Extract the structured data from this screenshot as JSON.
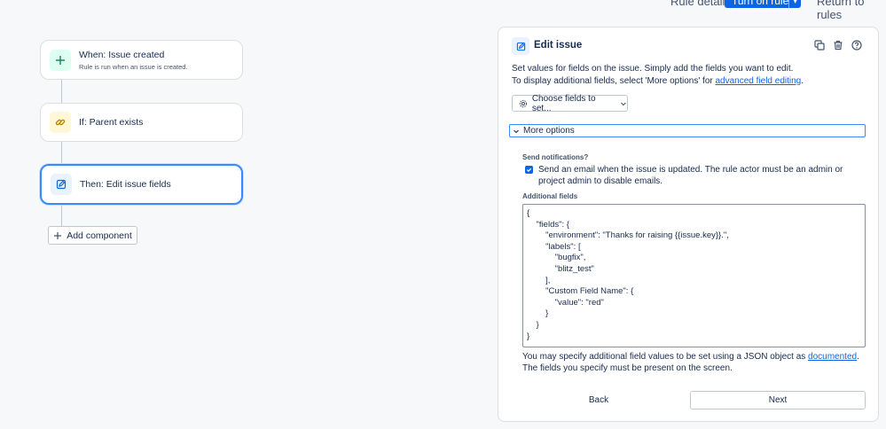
{
  "topbar": {
    "rule_details": "Rule details",
    "turn_on_rule": "Turn on rule",
    "return_to_rules": "Return to rules"
  },
  "flow": {
    "trigger": {
      "title": "When: Issue created",
      "subtitle": "Rule is run when an issue is created.",
      "icon": "plus-icon",
      "color": "#dcfff1"
    },
    "condition": {
      "title": "If: Parent exists",
      "icon": "link-icon",
      "color": "#fff7d6"
    },
    "action": {
      "title": "Then: Edit issue fields",
      "icon": "edit-icon",
      "color": "#e9f2ff"
    },
    "add_component": "Add component"
  },
  "panel": {
    "title": "Edit issue",
    "desc_line1": "Set values for fields on the issue. Simply add the fields you want to edit.",
    "desc_line2_prefix": "To display additional fields, select 'More options' for ",
    "desc_link": "advanced field editing",
    "desc_line2_suffix": ".",
    "choose_fields": "Choose fields to set...",
    "more_options": "More options",
    "send_notifications_label": "Send notifications?",
    "send_email_text": "Send an email when the issue is updated. The rule actor must be an admin or project admin to disable emails.",
    "send_email_checked": true,
    "additional_fields_label": "Additional fields",
    "additional_fields_value": "{\n    \"fields\": {\n        \"environment\": \"Thanks for raising {{issue.key}}.\",\n        \"labels\": [\n            \"bugfix\",\n            \"blitz_test\"\n        ],\n        \"Custom Field Name\": {\n            \"value\": \"red\"\n        }\n    }\n}",
    "help_prefix": "You may specify additional field values to be set using a JSON object as ",
    "help_link": "documented",
    "help_suffix": ". The fields you specify must be present on the screen.",
    "back": "Back",
    "next": "Next"
  }
}
